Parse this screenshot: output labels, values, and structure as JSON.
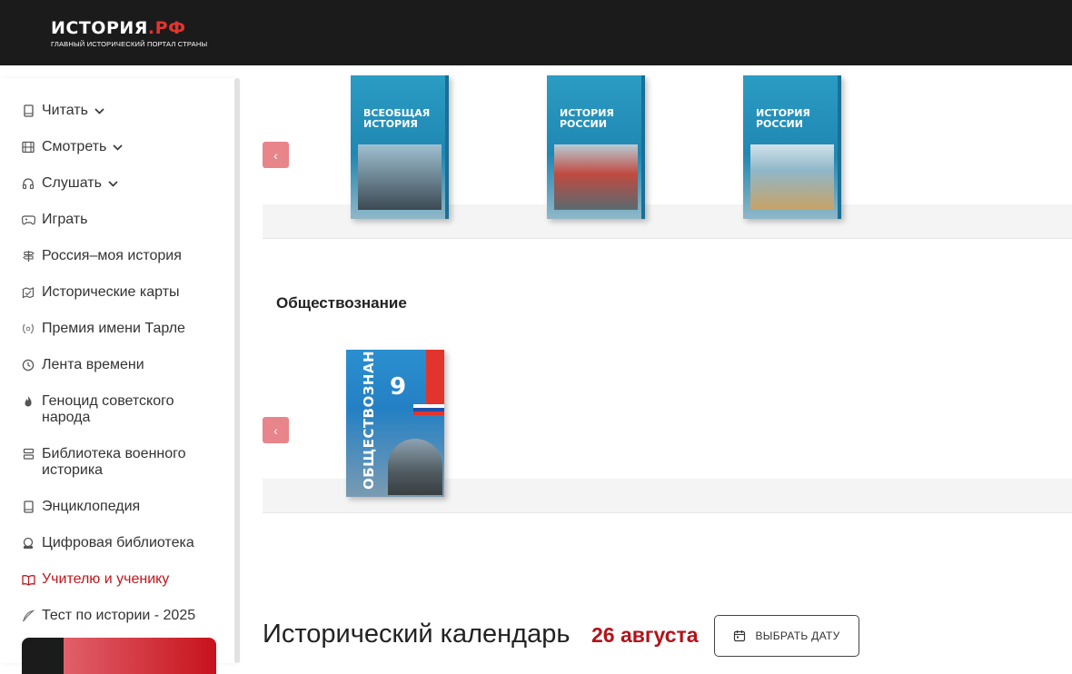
{
  "header": {
    "logo_main": "ИСТОРИЯ",
    "logo_dot": ".",
    "logo_rf": "РФ",
    "logo_sub": "ГЛАВНЫЙ ИСТОРИЧЕСКИЙ ПОРТАЛ СТРАНЫ"
  },
  "sidebar": {
    "items": [
      {
        "label": "Читать",
        "icon": "book-icon",
        "has_chevron": true
      },
      {
        "label": "Смотреть",
        "icon": "film-icon",
        "has_chevron": true
      },
      {
        "label": "Слушать",
        "icon": "headphones-icon",
        "has_chevron": true
      },
      {
        "label": "Играть",
        "icon": "gamepad-icon"
      },
      {
        "label": "Россия–моя история",
        "icon": "signpost-icon"
      },
      {
        "label": "Исторические карты",
        "icon": "map-icon"
      },
      {
        "label": "Премия имени Тарле",
        "icon": "laurel-icon"
      },
      {
        "label": "Лента времени",
        "icon": "clock-icon"
      },
      {
        "label": "Геноцид советского народа",
        "icon": "flame-icon"
      },
      {
        "label": "Библиотека военного историка",
        "icon": "stack-icon"
      },
      {
        "label": "Энциклопедия",
        "icon": "book-icon"
      },
      {
        "label": "Цифровая библиотека",
        "icon": "digital-library-icon"
      },
      {
        "label": "Учителю и ученику",
        "icon": "open-book-icon",
        "active": true
      },
      {
        "label": "Тест по истории - 2025",
        "icon": "quill-icon"
      }
    ],
    "active_color": "#c0161c"
  },
  "main": {
    "books_top": [
      {
        "title": "ВСЕОБЩАЯ ИСТОРИЯ"
      },
      {
        "title": "ИСТОРИЯ РОССИИ"
      },
      {
        "title": "ИСТОРИЯ РОССИИ"
      }
    ],
    "section_title": "Обществознание",
    "books_bottom": [
      {
        "title": "ОБЩЕСТВОЗНАНИЕ",
        "grade": "9"
      }
    ],
    "prev_arrow": "‹",
    "calendar": {
      "title": "Исторический календарь",
      "date": "26 августа",
      "button_label": "ВЫБРАТЬ ДАТУ"
    }
  },
  "colors": {
    "header_bg": "#1b1b1b",
    "accent": "#b31219",
    "arrow_bg": "#e8858a"
  }
}
